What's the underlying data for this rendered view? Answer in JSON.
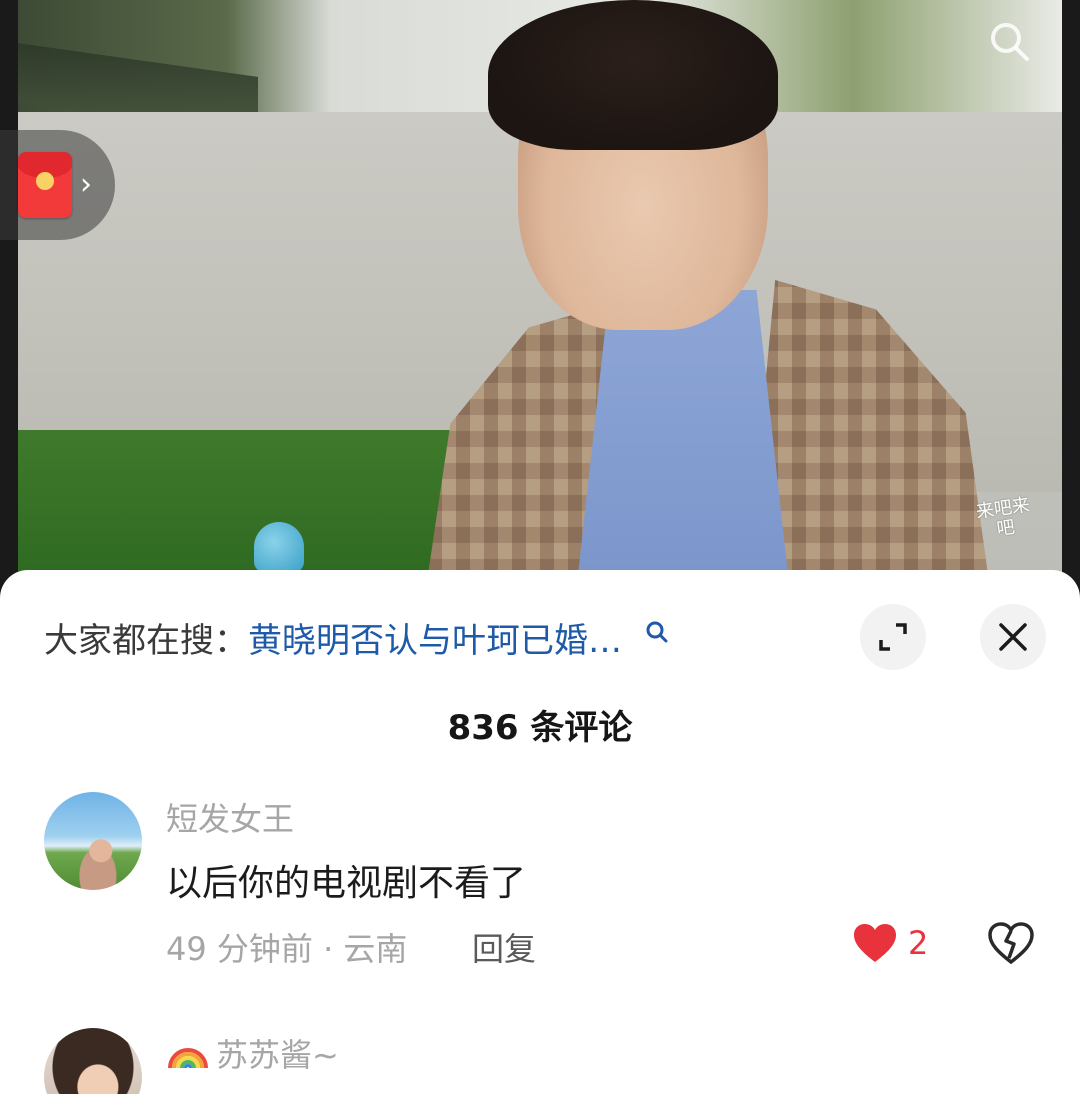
{
  "video": {
    "watermark_text": "来吧来吧",
    "has_search_button": true,
    "has_red_packet": true
  },
  "sheet": {
    "search_prefix": "大家都在搜：",
    "search_query": "黄晓明否认与叶珂已婚…",
    "comment_count_title": "836 条评论"
  },
  "comments": [
    {
      "username": "短发女王",
      "content": "以后你的电视剧不看了",
      "time_location": "49 分钟前 · 云南",
      "reply_label": "回复",
      "like_count": "2",
      "liked": true
    },
    {
      "username": "苏苏酱~",
      "username_prefix_icon": "rainbow-icon"
    }
  ],
  "colors": {
    "accent_link": "#1e5aa8",
    "like_red": "#e8323c",
    "muted_text": "#a6a6a6",
    "sheet_bg": "#ffffff"
  }
}
